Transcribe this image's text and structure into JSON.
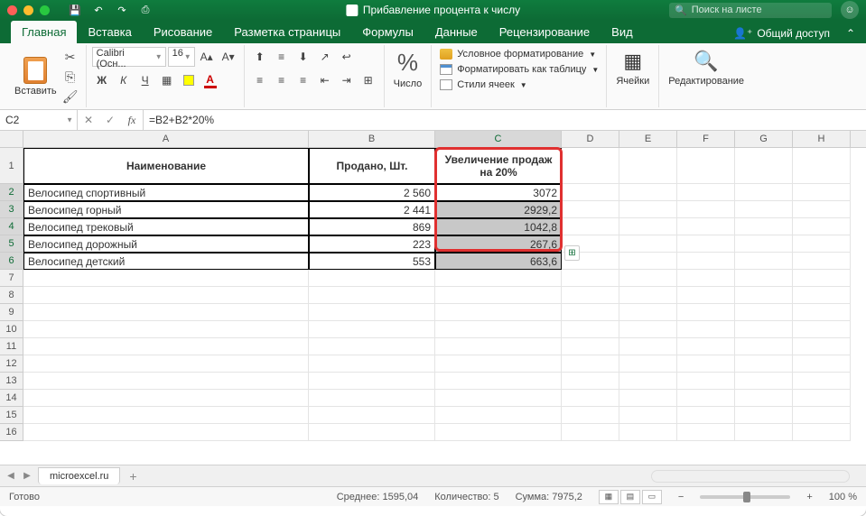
{
  "titlebar": {
    "window_title": "Прибавление процента к числу",
    "search_placeholder": "Поиск на листе"
  },
  "tabs": {
    "items": [
      "Главная",
      "Вставка",
      "Рисование",
      "Разметка страницы",
      "Формулы",
      "Данные",
      "Рецензирование",
      "Вид"
    ],
    "active": 0,
    "share_label": "Общий доступ"
  },
  "ribbon": {
    "paste_label": "Вставить",
    "font_name": "Calibri (Осн...",
    "font_size": "16",
    "number_label": "Число",
    "styles": {
      "cond_format": "Условное форматирование",
      "format_table": "Форматировать как таблицу",
      "cell_styles": "Стили ячеек"
    },
    "cells_label": "Ячейки",
    "editing_label": "Редактирование"
  },
  "formula_bar": {
    "cell_ref": "C2",
    "formula": "=B2+B2*20%"
  },
  "columns": [
    "A",
    "B",
    "C",
    "D",
    "E",
    "F",
    "G",
    "H"
  ],
  "headers": {
    "A": "Наименование",
    "B": "Продано, Шт.",
    "C": "Увеличение продаж на 20%"
  },
  "data_rows": [
    {
      "name": "Велосипед спортивный",
      "sold": "2 560",
      "inc": "3072"
    },
    {
      "name": "Велосипед горный",
      "sold": "2 441",
      "inc": "2929,2"
    },
    {
      "name": "Велосипед трековый",
      "sold": "869",
      "inc": "1042,8"
    },
    {
      "name": "Велосипед дорожный",
      "sold": "223",
      "inc": "267,6"
    },
    {
      "name": "Велосипед детский",
      "sold": "553",
      "inc": "663,6"
    }
  ],
  "sheet": {
    "name": "microexcel.ru"
  },
  "statusbar": {
    "ready": "Готово",
    "avg_label": "Среднее:",
    "avg_val": "1595,04",
    "count_label": "Количество:",
    "count_val": "5",
    "sum_label": "Сумма:",
    "sum_val": "7975,2",
    "zoom": "100 %"
  }
}
